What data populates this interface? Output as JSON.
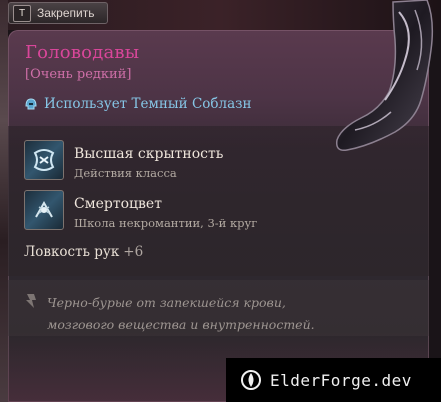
{
  "pin": {
    "key": "T",
    "label": "Закрепить"
  },
  "item": {
    "title": "Головодавы",
    "rarity": "[Очень редкий]",
    "uses": "Использует Темный Соблазн",
    "title_color": "#d9469a",
    "rarity_color": "#cf6fa8",
    "uses_color": "#86c6e6"
  },
  "spells": [
    {
      "name": "Высшая скрытность",
      "sub": "Действия класса",
      "icon": "mask-rune-icon"
    },
    {
      "name": "Смертоцвет",
      "sub": "Школа некромантии, 3-й круг",
      "icon": "death-flower-icon"
    }
  ],
  "stat": {
    "name": "Ловкость рук",
    "bonus": "+6"
  },
  "lore": {
    "line1": "Черно-бурые от запекшейся крови,",
    "line2": "мозгового вещества и внутренностей."
  },
  "watermark": {
    "text": "ElderForge.dev",
    "icon": "elderforge-logo-icon"
  }
}
